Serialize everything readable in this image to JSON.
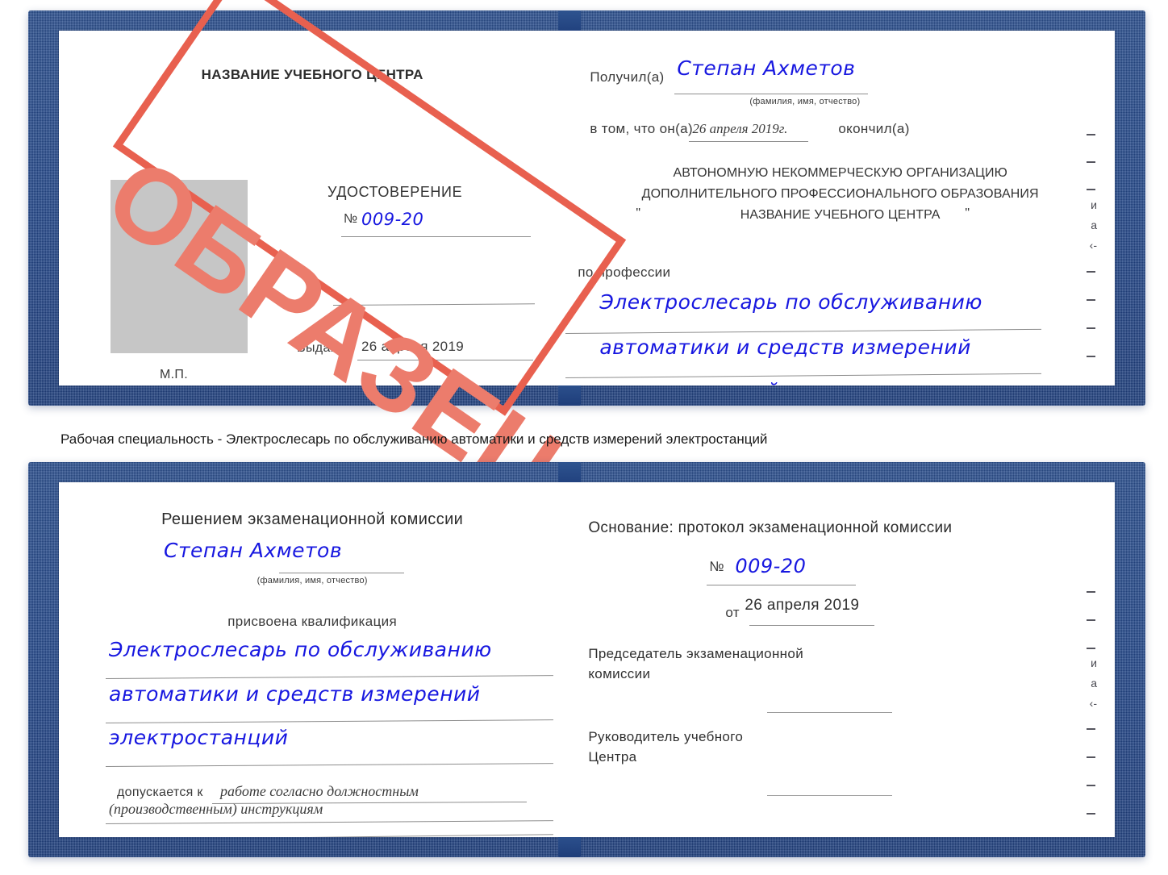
{
  "certificate_top": {
    "left_page": {
      "center_name": "НАЗВАНИЕ УЧЕБНОГО ЦЕНТРА",
      "doc_title": "УДОСТОВЕРЕНИЕ",
      "number_label": "№",
      "number_value": "009-20",
      "issued_label": "Выдано",
      "issued_value": "26 апреля 2019",
      "seal_label": "М.П.",
      "photo_placeholder": "photo-placeholder"
    },
    "right_page": {
      "received_label": "Получил(а)",
      "received_value": "Степан Ахметов",
      "name_hint": "(фамилия, имя, отчество)",
      "in_that_label": "в том, что он(а)",
      "in_that_value": "26 апреля 2019г.",
      "finished_label": "окончил(а)",
      "org_line1": "АВТОНОМНУЮ НЕКОММЕРЧЕСКУЮ ОРГАНИЗАЦИЮ",
      "org_line2": "ДОПОЛНИТЕЛЬНОГО ПРОФЕССИОНАЛЬНОГО ОБРАЗОВАНИЯ",
      "org_quote_open": "\"",
      "org_line3": "НАЗВАНИЕ УЧЕБНОГО ЦЕНТРА",
      "org_quote_close": "\"",
      "profession_label": "по профессии",
      "profession_line1": "Электрослесарь по обслуживанию",
      "profession_line2": "автоматики и средств измерений",
      "profession_line3": "электростанций"
    },
    "watermark": {
      "text": "ОБРАЗЕЦ",
      "color": "#ec7c6c",
      "frame_color": "#e8604f"
    },
    "edge_fragments": [
      "–",
      "–",
      "–",
      "и",
      "а",
      "‹-",
      "–",
      "–",
      "–",
      "–"
    ]
  },
  "caption": {
    "text": "Рабочая специальность - Электрослесарь по обслуживанию автоматики и средств измерений электростанций"
  },
  "certificate_bottom": {
    "left_page": {
      "commission_title": "Решением экзаменационной комиссии",
      "name_value": "Степан Ахметов",
      "name_hint": "(фамилия, имя, отчество)",
      "qualification_label": "присвоена квалификация",
      "qualification_line1": "Электрослесарь по обслуживанию",
      "qualification_line2": "автоматики и средств измерений",
      "qualification_line3": "электростанций",
      "allowed_label": "допускается к",
      "allowed_value1": "работе согласно должностным",
      "allowed_value2": "(производственным) инструкциям"
    },
    "right_page": {
      "basis_label": "Основание: протокол экзаменационной комиссии",
      "number_label": "№",
      "number_value": "009-20",
      "date_label": "от",
      "date_value": "26 апреля 2019",
      "chairman_line1": "Председатель экзаменационной",
      "chairman_line2": "комиссии",
      "head_line1": "Руководитель учебного",
      "head_line2": "Центра"
    },
    "edge_fragments": [
      "–",
      "–",
      "–",
      "и",
      "а",
      "‹-",
      "–",
      "–",
      "–",
      "–"
    ]
  }
}
